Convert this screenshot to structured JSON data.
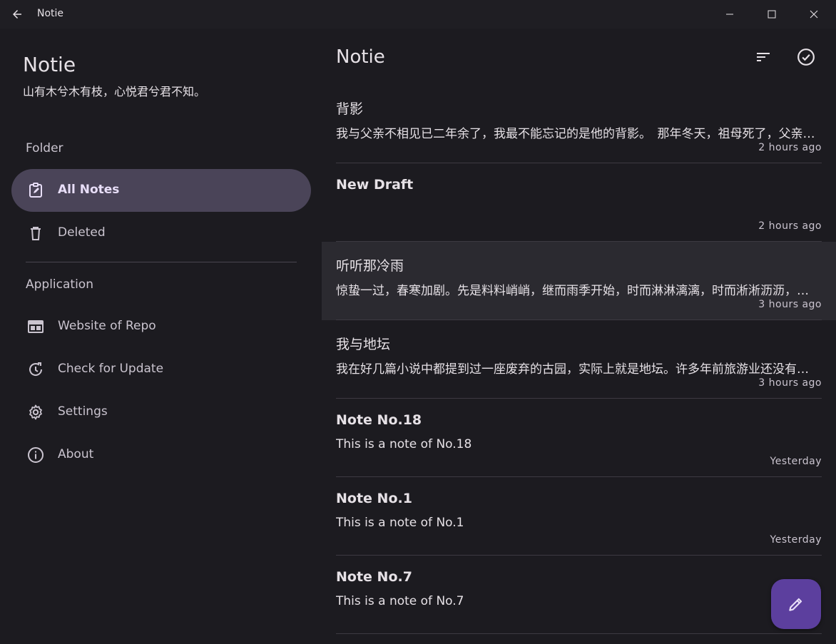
{
  "window": {
    "title": "Notie"
  },
  "sidebar": {
    "app_name": "Notie",
    "subtitle": "山有木兮木有枝，心悦君兮君不知。",
    "folder_label": "Folder",
    "application_label": "Application",
    "folder_items": [
      {
        "label": "All Notes",
        "icon": "clipboard-edit-icon",
        "active": true
      },
      {
        "label": "Deleted",
        "icon": "trash-icon",
        "active": false
      }
    ],
    "app_items": [
      {
        "label": "Website of Repo",
        "icon": "web-icon"
      },
      {
        "label": "Check for Update",
        "icon": "update-icon"
      },
      {
        "label": "Settings",
        "icon": "gear-icon"
      },
      {
        "label": "About",
        "icon": "info-icon"
      }
    ]
  },
  "main": {
    "title": "Notie",
    "notes": [
      {
        "title": "背影",
        "body": "我与父亲不相见已二年余了，我最不能忘记的是他的背影。　那年冬天，祖母死了，父亲的差使也交卸了，正是祸不单行的日子",
        "time": "2 hours ago"
      },
      {
        "title": "New Draft",
        "body": "",
        "time": "2 hours ago"
      },
      {
        "title": "听听那冷雨",
        "body": "惊蛰一过，春寒加剧。先是料料峭峭，继而雨季开始，时而淋淋漓漓，时而淅淅沥沥，天潮潮地湿湿",
        "time": "3 hours ago"
      },
      {
        "title": "我与地坛",
        "body": "我在好几篇小说中都提到过一座废弃的古园，实际上就是地坛。许多年前旅游业还没有开展，园子荒芜冷落得如同一片野地",
        "time": "3 hours ago"
      },
      {
        "title": "Note No.18",
        "body": "This is a note of No.18",
        "time": "Yesterday"
      },
      {
        "title": "Note No.1",
        "body": "This is a note of No.1",
        "time": "Yesterday"
      },
      {
        "title": "Note No.7",
        "body": "This is a note of No.7",
        "time": ""
      }
    ]
  },
  "colors": {
    "background": "#1c1b20",
    "active_nav": "#4a4458",
    "fab": "#5c3f9e",
    "hover_row": "#2b2a30"
  }
}
